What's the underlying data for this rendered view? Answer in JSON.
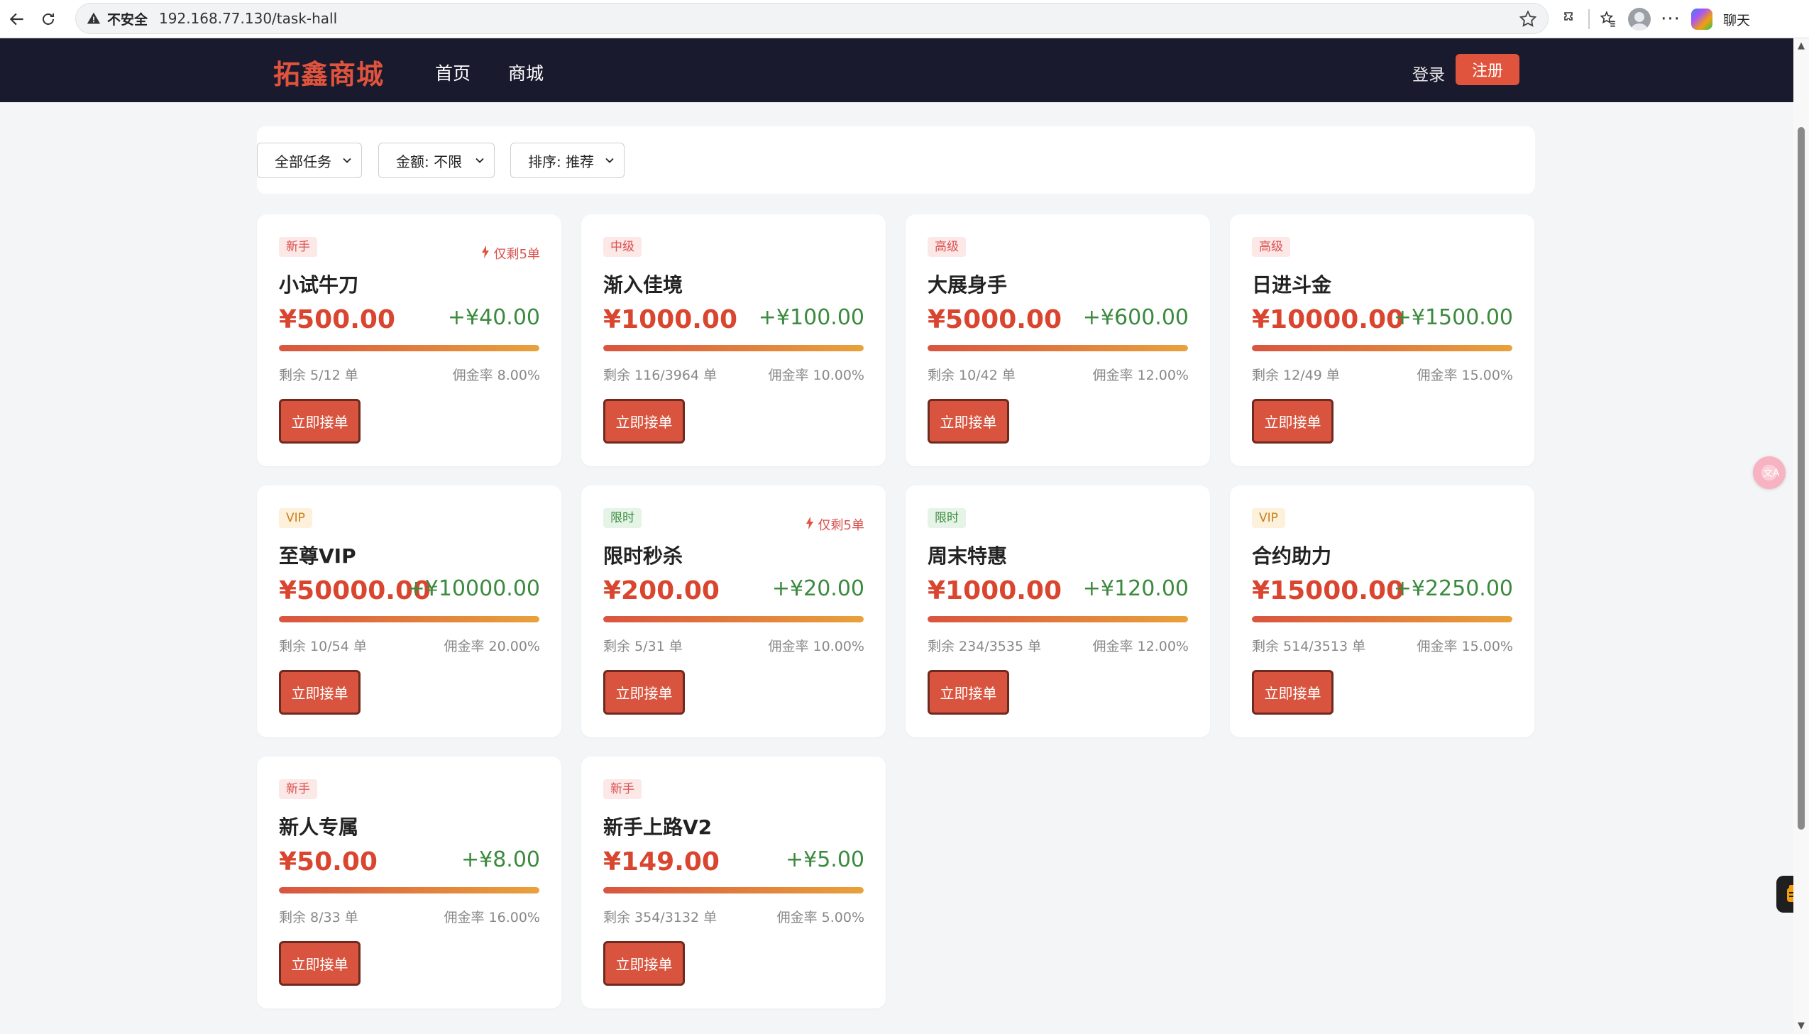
{
  "browser": {
    "insecure_label": "不安全",
    "url": "192.168.77.130/task-hall",
    "chat_label": "聊天"
  },
  "header": {
    "logo": "拓鑫商城",
    "nav": [
      "首页",
      "商城"
    ],
    "login": "登录",
    "register": "注册"
  },
  "filters": {
    "type": "全部任务",
    "amount": "金额: 不限",
    "sort": "排序: 推荐"
  },
  "tasks": [
    {
      "badge": "新手",
      "badge_kind": "newbie",
      "scarcity": "仅剩5单",
      "title": "小试牛刀",
      "price": "¥500.00",
      "commission": "+¥40.00",
      "remaining": "剩余 5/12 单",
      "rate": "佣金率 8.00%",
      "button": "立即接单",
      "progress": 1.0
    },
    {
      "badge": "中级",
      "badge_kind": "mid",
      "scarcity": "",
      "title": "渐入佳境",
      "price": "¥1000.00",
      "commission": "+¥100.00",
      "remaining": "剩余 116/3964 单",
      "rate": "佣金率 10.00%",
      "button": "立即接单",
      "progress": 1.0
    },
    {
      "badge": "高级",
      "badge_kind": "high",
      "scarcity": "",
      "title": "大展身手",
      "price": "¥5000.00",
      "commission": "+¥600.00",
      "remaining": "剩余 10/42 单",
      "rate": "佣金率 12.00%",
      "button": "立即接单",
      "progress": 1.0
    },
    {
      "badge": "高级",
      "badge_kind": "high",
      "scarcity": "",
      "title": "日进斗金",
      "price": "¥10000.00",
      "commission": "+¥1500.00",
      "remaining": "剩余 12/49 单",
      "rate": "佣金率 15.00%",
      "button": "立即接单",
      "progress": 1.0
    },
    {
      "badge": "VIP",
      "badge_kind": "vip",
      "scarcity": "",
      "title": "至尊VIP",
      "price": "¥50000.00",
      "commission": "+¥10000.00",
      "remaining": "剩余 10/54 单",
      "rate": "佣金率 20.00%",
      "button": "立即接单",
      "progress": 1.0
    },
    {
      "badge": "限时",
      "badge_kind": "limited",
      "scarcity": "仅剩5单",
      "title": "限时秒杀",
      "price": "¥200.00",
      "commission": "+¥20.00",
      "remaining": "剩余 5/31 单",
      "rate": "佣金率 10.00%",
      "button": "立即接单",
      "progress": 1.0
    },
    {
      "badge": "限时",
      "badge_kind": "limited",
      "scarcity": "",
      "title": "周末特惠",
      "price": "¥1000.00",
      "commission": "+¥120.00",
      "remaining": "剩余 234/3535 单",
      "rate": "佣金率 12.00%",
      "button": "立即接单",
      "progress": 1.0
    },
    {
      "badge": "VIP",
      "badge_kind": "vip",
      "scarcity": "",
      "title": "合约助力",
      "price": "¥15000.00",
      "commission": "+¥2250.00",
      "remaining": "剩余 514/3513 单",
      "rate": "佣金率 15.00%",
      "button": "立即接单",
      "progress": 1.0
    },
    {
      "badge": "新手",
      "badge_kind": "newbie",
      "scarcity": "",
      "title": "新人专属",
      "price": "¥50.00",
      "commission": "+¥8.00",
      "remaining": "剩余 8/33 单",
      "rate": "佣金率 16.00%",
      "button": "立即接单",
      "progress": 1.0
    },
    {
      "badge": "新手",
      "badge_kind": "newbie",
      "scarcity": "",
      "title": "新手上路V2",
      "price": "¥149.00",
      "commission": "+¥5.00",
      "remaining": "剩余 354/3132 单",
      "rate": "佣金率 5.00%",
      "button": "立即接单",
      "progress": 1.0
    }
  ],
  "colors": {
    "brand": "#e0533c",
    "header_bg": "#1a1a2e",
    "price": "#d9452f",
    "commission": "#3b8a3e"
  }
}
